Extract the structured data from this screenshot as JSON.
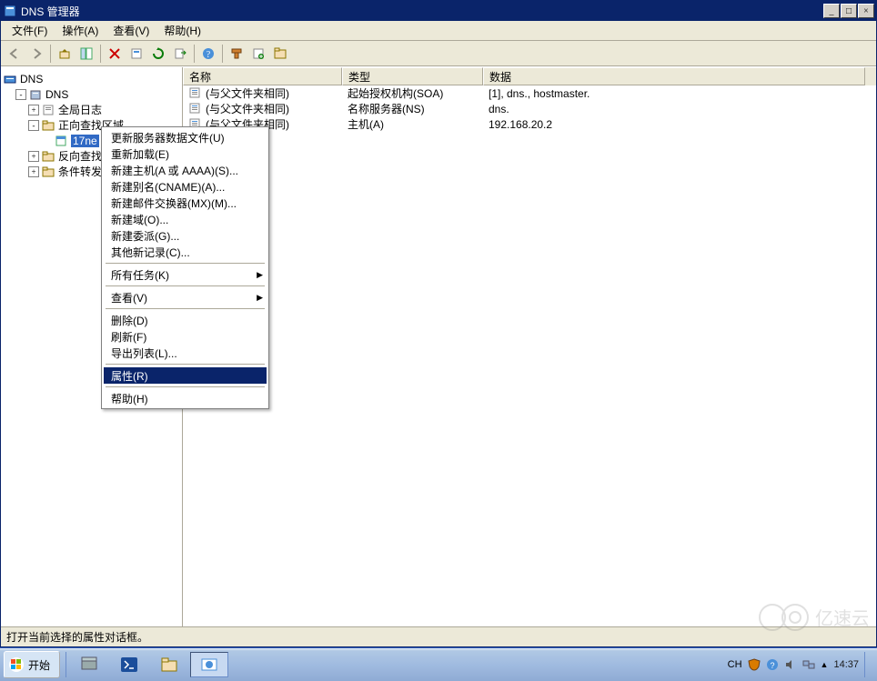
{
  "window": {
    "title": "DNS 管理器",
    "buttons": {
      "min": "_",
      "max": "□",
      "close": "×"
    }
  },
  "menubar": [
    {
      "label": "文件(F)"
    },
    {
      "label": "操作(A)"
    },
    {
      "label": "查看(V)"
    },
    {
      "label": "帮助(H)"
    }
  ],
  "tree": {
    "root_label": "DNS",
    "nodes": [
      {
        "indent": 1,
        "exp": "-",
        "icon": "server",
        "label": "DNS"
      },
      {
        "indent": 2,
        "exp": "+",
        "icon": "log",
        "label": "全局日志"
      },
      {
        "indent": 2,
        "exp": "-",
        "icon": "folder",
        "label": "正向查找区域"
      },
      {
        "indent": 3,
        "exp": " ",
        "icon": "zone",
        "label": "17ne",
        "selected": true
      },
      {
        "indent": 2,
        "exp": "+",
        "icon": "folder",
        "label": "反向查找"
      },
      {
        "indent": 2,
        "exp": "+",
        "icon": "folder",
        "label": "条件转发"
      }
    ]
  },
  "list": {
    "columns": [
      "名称",
      "类型",
      "数据"
    ],
    "rows": [
      {
        "name": "(与父文件夹相同)",
        "type": "起始授权机构(SOA)",
        "data": "[1], dns., hostmaster."
      },
      {
        "name": "(与父文件夹相同)",
        "type": "名称服务器(NS)",
        "data": "dns."
      },
      {
        "name": "(与父文件夹相同)",
        "type": "主机(A)",
        "data": "192.168.20.2"
      }
    ]
  },
  "context_menu": [
    {
      "label": "更新服务器数据文件(U)"
    },
    {
      "label": "重新加载(E)"
    },
    {
      "label": "新建主机(A 或 AAAA)(S)..."
    },
    {
      "label": "新建别名(CNAME)(A)..."
    },
    {
      "label": "新建邮件交换器(MX)(M)..."
    },
    {
      "label": "新建域(O)..."
    },
    {
      "label": "新建委派(G)..."
    },
    {
      "label": "其他新记录(C)..."
    },
    {
      "sep": true
    },
    {
      "label": "所有任务(K)",
      "submenu": true
    },
    {
      "sep": true
    },
    {
      "label": "查看(V)",
      "submenu": true
    },
    {
      "sep": true
    },
    {
      "label": "删除(D)"
    },
    {
      "label": "刷新(F)"
    },
    {
      "label": "导出列表(L)..."
    },
    {
      "sep": true
    },
    {
      "label": "属性(R)",
      "highlight": true
    },
    {
      "sep": true
    },
    {
      "label": "帮助(H)"
    }
  ],
  "status": "打开当前选择的属性对话框。",
  "taskbar": {
    "start": "开始",
    "lang": "CH",
    "time": "14:37",
    "date": ""
  },
  "watermark": "亿速云"
}
